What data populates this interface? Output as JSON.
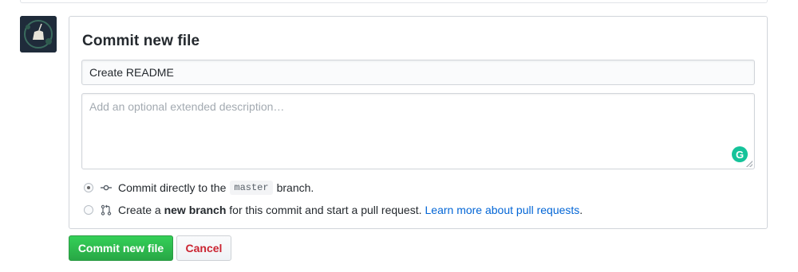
{
  "commit_form": {
    "title": "Commit new file",
    "summary_value": "Create README",
    "description_placeholder": "Add an optional extended description…",
    "grammarly_glyph": "G",
    "option_direct": {
      "prefix": "Commit directly to the",
      "branch": "master",
      "suffix": "branch.",
      "selected": true
    },
    "option_new_branch": {
      "prefix": "Create a",
      "emphasis": "new branch",
      "suffix": "for this commit and start a pull request.",
      "link": "Learn more about pull requests",
      "link_end": ".",
      "selected": false
    }
  },
  "buttons": {
    "commit_label": "Commit new file",
    "cancel_label": "Cancel"
  },
  "icons": {
    "avatar": "user-avatar-unicorn",
    "commit": "git-commit-icon",
    "pull_request": "git-pull-request-icon",
    "grammarly": "grammarly-icon"
  },
  "colors": {
    "primary_green": "#28a745",
    "danger_red": "#cb2431",
    "link_blue": "#0366d6"
  }
}
